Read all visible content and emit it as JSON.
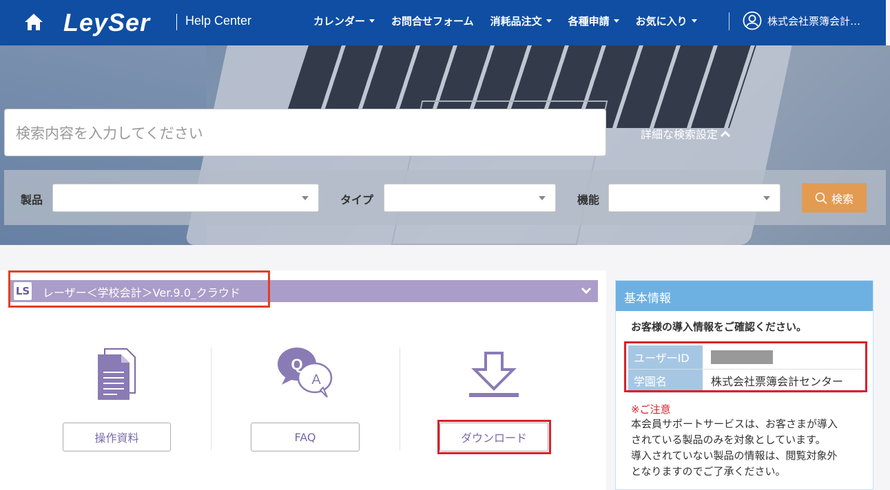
{
  "header": {
    "logo": "LeySer",
    "help_center": "Help Center",
    "nav": [
      {
        "label": "カレンダー",
        "dropdown": true
      },
      {
        "label": "お問合せフォーム",
        "dropdown": false
      },
      {
        "label": "消耗品注文",
        "dropdown": true
      },
      {
        "label": "各種申請",
        "dropdown": true
      },
      {
        "label": "お気に入り",
        "dropdown": true
      }
    ],
    "user": "株式会社票簿会計…"
  },
  "search": {
    "placeholder": "検索内容を入力してください",
    "advanced": "詳細な検索設定",
    "filters": [
      {
        "label": "製品",
        "value": ""
      },
      {
        "label": "タイプ",
        "value": ""
      },
      {
        "label": "機能",
        "value": ""
      }
    ],
    "button": "検索"
  },
  "product": {
    "logo": "LS",
    "name": "レーザー＜学校会計＞Ver.9.0_クラウド",
    "actions": [
      {
        "label": "操作資料",
        "icon": "document-icon"
      },
      {
        "label": "FAQ",
        "icon": "faq-icon"
      },
      {
        "label": "ダウンロード",
        "icon": "download-icon"
      }
    ]
  },
  "basic_info": {
    "title": "基本情報",
    "lead": "お客様の導入情報をご確認ください。",
    "rows": [
      {
        "key": "ユーザーID",
        "value": ""
      },
      {
        "key": "学園名",
        "value": "株式会社票簿会計センター"
      }
    ],
    "note_title": "※ご注意",
    "note_lines": [
      "本会員サポートサービスは、お客さまが導入",
      "されている製品のみを対象としています。",
      "導入されていない製品の情報は、閲覧対象外",
      "となりますのでご了承ください。"
    ]
  },
  "colors": {
    "header": "#0f4ea3",
    "product_bar": "#ab9dc9",
    "accent_purple": "#7a6aa8",
    "search_button": "#e39b52",
    "side_head": "#6db1e3",
    "highlight": "#d8202a"
  }
}
